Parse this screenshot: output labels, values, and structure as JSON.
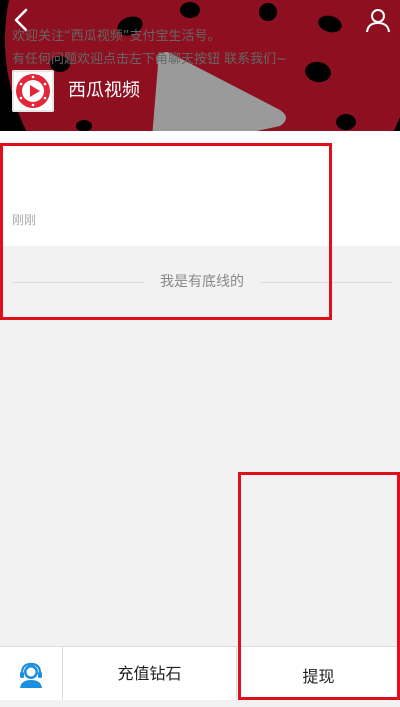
{
  "header": {
    "account_name": "西瓜视频"
  },
  "message": {
    "line1": "欢迎关注“西瓜视频”支付宝生活号。",
    "line2": "有任何问题欢迎点击左下角聊天按钮 联系我们~",
    "time": "刚刚"
  },
  "feed": {
    "end_text": "我是有底线的"
  },
  "bottom_bar": {
    "recharge_label": "充值钻石",
    "withdraw_label": "提现"
  },
  "colors": {
    "brand_red": "#8e1020",
    "highlight_red": "#e0101a",
    "service_blue": "#1b8fe0"
  },
  "icons": [
    "back-icon",
    "profile-icon",
    "watermelon-play-logo",
    "customer-service-icon"
  ]
}
